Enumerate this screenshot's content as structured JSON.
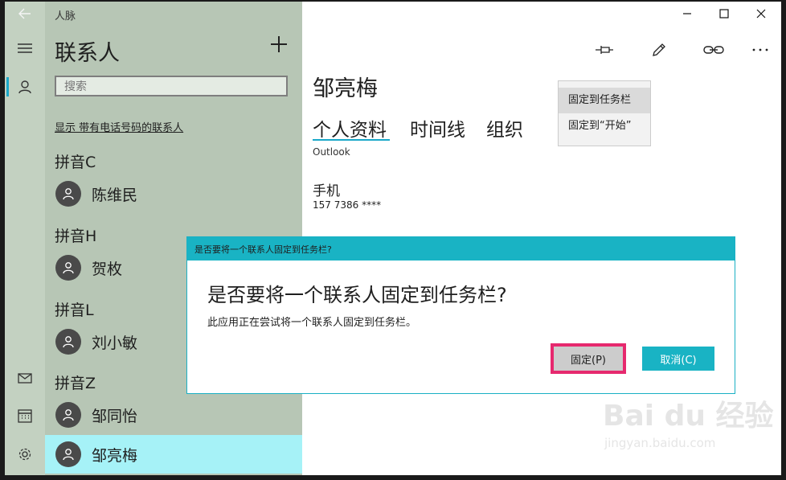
{
  "window": {
    "title": "人脉"
  },
  "left_pane": {
    "title": "联系人",
    "search_placeholder": "搜索",
    "filter_link": "显示 带有电话号码的联系人",
    "groups": [
      {
        "header": "拼音C",
        "contacts": [
          "陈维民"
        ]
      },
      {
        "header": "拼音H",
        "contacts": [
          "贺枚"
        ]
      },
      {
        "header": "拼音L",
        "contacts": [
          "刘小敏"
        ]
      },
      {
        "header": "拼音Z",
        "contacts": [
          "邹同怡",
          "邹亮梅"
        ]
      }
    ],
    "selected_contact": "邹亮梅"
  },
  "contact": {
    "name": "邹亮梅",
    "tabs": [
      "个人资料",
      "时间线",
      "组织"
    ],
    "active_tab": "个人资料",
    "source": "Outlook",
    "field_label": "手机",
    "field_value": "157 7386 ****"
  },
  "pin_menu": {
    "items": [
      "固定到任务栏",
      "固定到“开始”"
    ],
    "hovered": "固定到任务栏"
  },
  "dialog": {
    "title": "是否要将一个联系人固定到任务栏?",
    "heading": "是否要将一个联系人固定到任务栏?",
    "body": "此应用正在尝试将一个联系人固定到任务栏。",
    "ok_label": "固定(P)",
    "cancel_label": "取消(C)"
  },
  "watermark": {
    "text": "Bai du 经验",
    "sub": "jingyan.baidu.com"
  },
  "colors": {
    "accent": "#19b3c4",
    "highlight": "#e6296e",
    "selected": "#a6f2f7"
  }
}
